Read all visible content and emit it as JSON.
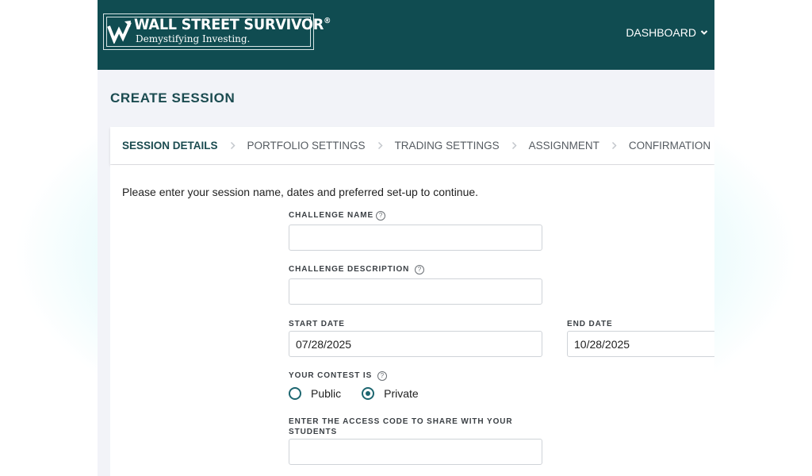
{
  "header": {
    "brand_name": "WALL STREET SURVIVOR",
    "brand_mark": "®",
    "tagline": "Demystifying Investing.",
    "nav_label": "DASHBOARD",
    "nav_icon": "chevron-down-icon"
  },
  "page": {
    "title": "CREATE SESSION"
  },
  "steps": [
    {
      "label": "SESSION DETAILS",
      "active": true
    },
    {
      "label": "PORTFOLIO SETTINGS",
      "active": false
    },
    {
      "label": "TRADING SETTINGS",
      "active": false
    },
    {
      "label": "ASSIGNMENT",
      "active": false
    },
    {
      "label": "CONFIRMATION",
      "active": false
    }
  ],
  "form": {
    "intro": "Please enter your session name, dates and preferred set-up to continue.",
    "challenge_name": {
      "label": "CHALLENGE NAME",
      "value": ""
    },
    "challenge_description": {
      "label": "CHALLENGE DESCRIPTION",
      "value": ""
    },
    "start_date": {
      "label": "START DATE",
      "value": "07/28/2025"
    },
    "end_date": {
      "label": "END DATE",
      "value": "10/28/2025"
    },
    "contest_type": {
      "label": "YOUR CONTEST IS",
      "options": [
        "Public",
        "Private"
      ],
      "selected": "Private"
    },
    "access_code": {
      "label": "ENTER THE ACCESS CODE TO SHARE WITH YOUR STUDENTS",
      "value": ""
    },
    "help_icon": "?"
  },
  "colors": {
    "header_bg": "#104c51",
    "title": "#1b4b50",
    "radio_accent": "#1d6670",
    "page_bg": "#f2f3f8"
  }
}
